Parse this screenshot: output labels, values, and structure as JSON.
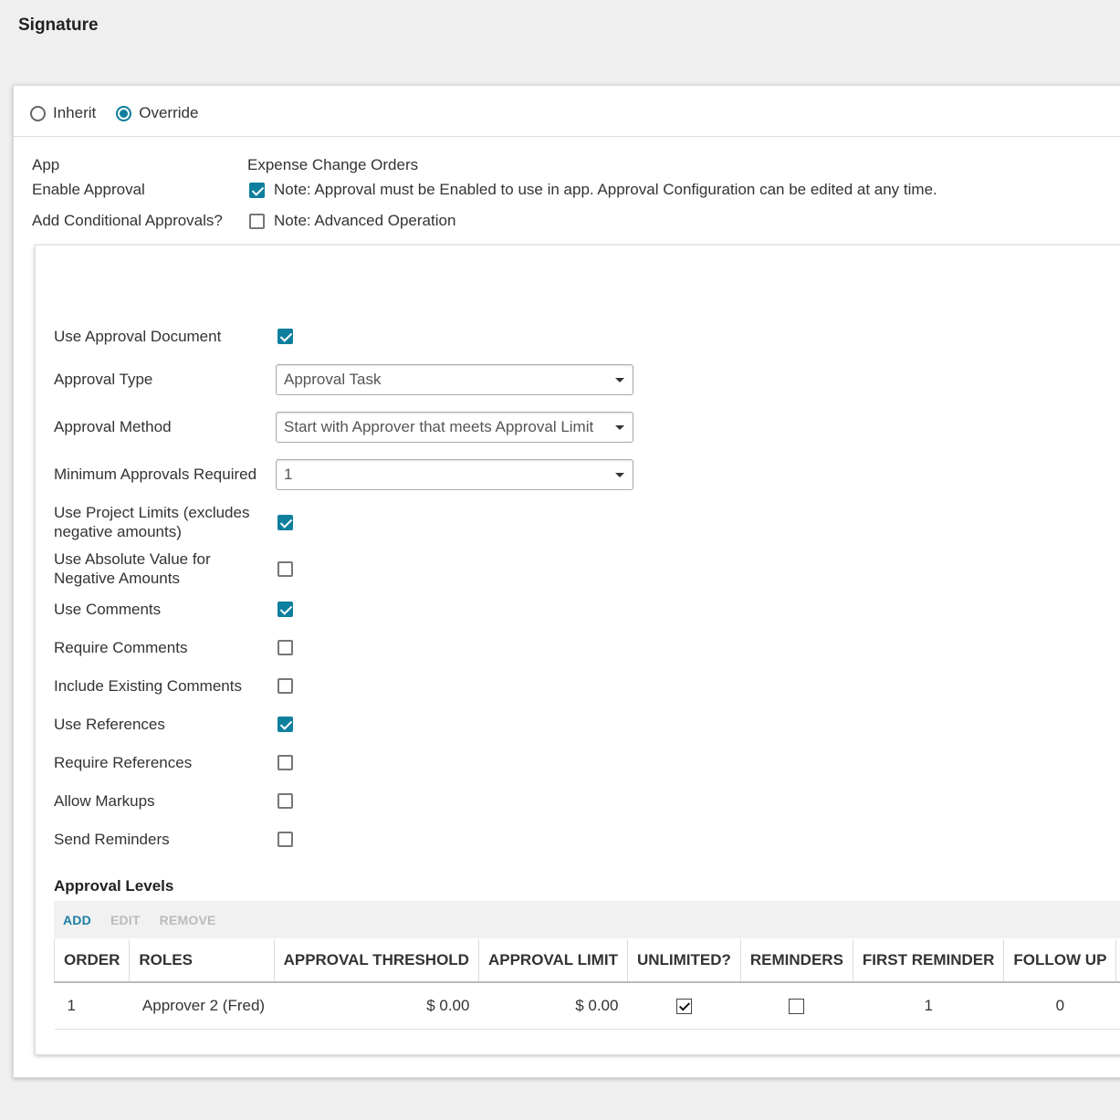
{
  "page_title": "Signature",
  "mode": {
    "options": [
      "Inherit",
      "Override"
    ],
    "selected": "Override"
  },
  "info": {
    "app_label": "App",
    "app_value": "Expense Change Orders",
    "enable_label": "Enable Approval",
    "enable_checked": true,
    "enable_note": "Note:  Approval must be Enabled to use in app.  Approval Configuration can be edited at any time.",
    "conditional_label": "Add Conditional Approvals?",
    "conditional_checked": false,
    "conditional_note": "Note:  Advanced Operation"
  },
  "form": {
    "use_approval_document": "Use Approval Document",
    "approval_type_label": "Approval Type",
    "approval_type_value": "Approval Task",
    "approval_method_label": "Approval Method",
    "approval_method_value": "Start with Approver that meets Approval Limit",
    "min_approvals_label": "Minimum Approvals Required",
    "min_approvals_value": "1",
    "use_project_limits": "Use Project Limits (excludes negative amounts)",
    "use_absolute_value": "Use Absolute Value for Negative Amounts",
    "use_comments": "Use Comments",
    "require_comments": "Require Comments",
    "include_existing_comments": "Include Existing Comments",
    "use_references": "Use References",
    "require_references": "Require References",
    "allow_markups": "Allow Markups",
    "send_reminders": "Send Reminders"
  },
  "checks": {
    "use_approval_document": true,
    "use_project_limits": true,
    "use_absolute_value": false,
    "use_comments": true,
    "require_comments": false,
    "include_existing_comments": false,
    "use_references": true,
    "require_references": false,
    "allow_markups": false,
    "send_reminders": false
  },
  "levels": {
    "title": "Approval Levels",
    "toolbar": {
      "add": "ADD",
      "edit": "EDIT",
      "remove": "REMOVE"
    },
    "columns": [
      "ORDER",
      "ROLES",
      "APPROVAL THRESHOLD",
      "APPROVAL LIMIT",
      "UNLIMITED?",
      "REMINDERS",
      "FIRST REMINDER",
      "FOLLOW UP"
    ],
    "rows": [
      {
        "order": "1",
        "roles": "Approver 2 (Fred)",
        "threshold": "$ 0.00",
        "limit": "$ 0.00",
        "unlimited": true,
        "reminders": false,
        "first_reminder": "1",
        "follow_up": "0"
      }
    ]
  },
  "colors": {
    "accent": "#0e7f9c",
    "link": "#1a7fa3",
    "page_bg": "#efefef"
  }
}
